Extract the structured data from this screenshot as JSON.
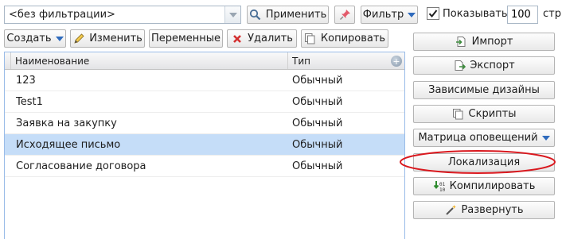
{
  "filter": {
    "value": "<без фильтрации>"
  },
  "toolbar": {
    "apply_label": "Применить",
    "filter_label": "Фильтр",
    "show_label": "Показывать",
    "count_value": "100",
    "per_label": "стр"
  },
  "actions": {
    "create_label": "Создать",
    "edit_label": "Изменить",
    "variables_label": "Переменные",
    "delete_label": "Удалить",
    "copy_label": "Копировать"
  },
  "grid": {
    "columns": [
      "Наименование",
      "Тип"
    ],
    "rows": [
      {
        "name": "123",
        "type": "Обычный"
      },
      {
        "name": "Test1",
        "type": "Обычный"
      },
      {
        "name": "Заявка на закупку",
        "type": "Обычный"
      },
      {
        "name": "Исходящее письмо",
        "type": "Обычный"
      },
      {
        "name": "Согласование договора",
        "type": "Обычный"
      }
    ]
  },
  "side": {
    "import_label": "Импорт",
    "export_label": "Экспорт",
    "dependent_label": "Зависимые дизайны",
    "scripts_label": "Скрипты",
    "matrix_label": "Матрица оповещений",
    "localization_label": "Локализация",
    "compile_label": "Компилировать",
    "deploy_label": "Развернуть"
  },
  "colors": {
    "selected_row": "#c5ddf8",
    "grid_border": "#99bbe8",
    "highlight_ellipse": "#d9181e",
    "accent_blue": "#2f6bbd"
  }
}
